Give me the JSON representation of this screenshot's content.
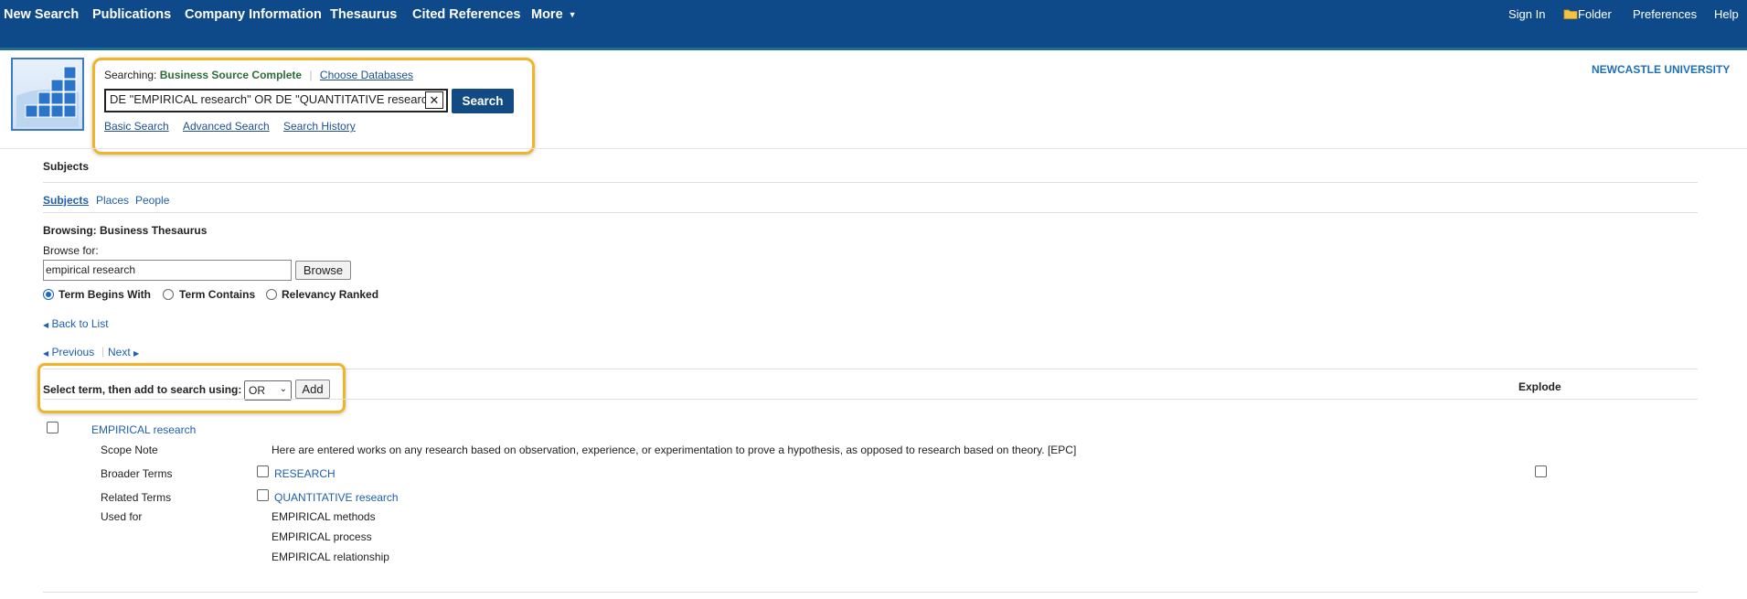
{
  "nav": {
    "new_search": "New Search",
    "publications": "Publications",
    "company_information": "Company Information",
    "thesaurus": "Thesaurus",
    "cited_references": "Cited References",
    "more": "More",
    "sign_in": "Sign In",
    "folder": "Folder",
    "preferences": "Preferences",
    "help": "Help"
  },
  "search": {
    "searching_label": "Searching:",
    "database": "Business Source Complete",
    "choose_databases": "Choose Databases",
    "query": "DE \"EMPIRICAL research\" OR DE \"QUANTITATIVE research\"",
    "clear_icon": "close-icon",
    "clear_glyph": "✕",
    "search_button": "Search",
    "basic_search": "Basic Search",
    "advanced_search": "Advanced Search",
    "search_history": "Search History"
  },
  "institution": "NEWCASTLE UNIVERSITY",
  "thesaurus": {
    "section_title": "Subjects",
    "tabs": [
      "Subjects",
      "Places",
      "People"
    ],
    "browsing": "Browsing: Business Thesaurus",
    "browse_for_label": "Browse for:",
    "browse_value": "empirical research",
    "browse_button": "Browse",
    "options": [
      {
        "label": "Term Begins With",
        "selected": true
      },
      {
        "label": "Term Contains",
        "selected": false
      },
      {
        "label": "Relevancy Ranked",
        "selected": false
      }
    ],
    "back_to_list": "Back to List",
    "previous": "Previous",
    "next": "Next",
    "select_term_label": "Select term, then add to search using:",
    "operator": "OR",
    "add_button": "Add",
    "explode_header": "Explode",
    "term": {
      "name": "EMPIRICAL research",
      "scope_note_label": "Scope Note",
      "scope_note": "Here are entered works on any research based on observation, experience, or experimentation to prove a hypothesis, as opposed to research based on theory. [EPC]",
      "broader_terms_label": "Broader Terms",
      "broader_term": "RESEARCH",
      "related_terms_label": "Related Terms",
      "related_term": "QUANTITATIVE research",
      "used_for_label": "Used for",
      "used_for": [
        "EMPIRICAL methods",
        "EMPIRICAL process",
        "EMPIRICAL relationship"
      ]
    }
  },
  "colors": {
    "topbar": "#0e4a8a",
    "highlight": "#f0b429",
    "link": "#1d5fb0",
    "search_button": "#124b84"
  }
}
